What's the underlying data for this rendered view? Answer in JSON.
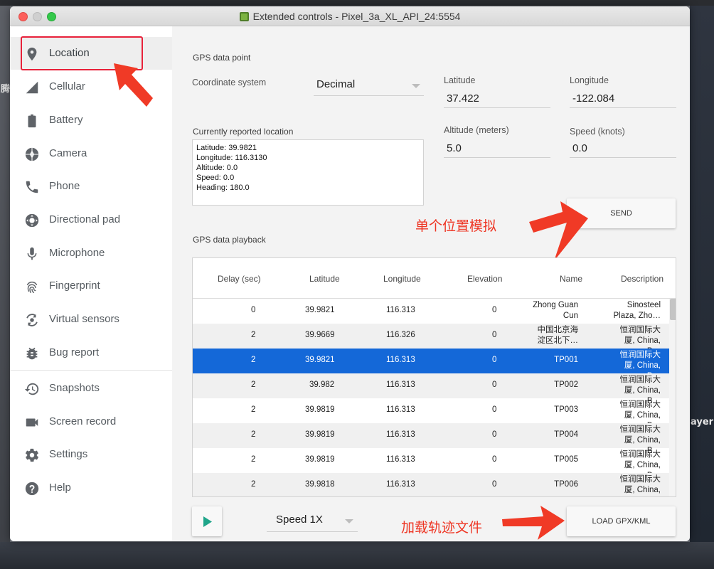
{
  "window": {
    "title": "Extended controls - Pixel_3a_XL_API_24:5554"
  },
  "desktop": {
    "right_edge_text": "ayer",
    "left_edge_text": "腾"
  },
  "sidebar": {
    "items": [
      {
        "label": "Location",
        "icon": "location-pin-icon",
        "active": true
      },
      {
        "label": "Cellular",
        "icon": "cellular-signal-icon"
      },
      {
        "label": "Battery",
        "icon": "battery-icon"
      },
      {
        "label": "Camera",
        "icon": "camera-aperture-icon"
      },
      {
        "label": "Phone",
        "icon": "phone-icon"
      },
      {
        "label": "Directional pad",
        "icon": "dpad-icon"
      },
      {
        "label": "Microphone",
        "icon": "microphone-icon"
      },
      {
        "label": "Fingerprint",
        "icon": "fingerprint-icon"
      },
      {
        "label": "Virtual sensors",
        "icon": "rotation-sensor-icon"
      },
      {
        "label": "Bug report",
        "icon": "bug-icon"
      },
      {
        "label": "Snapshots",
        "icon": "history-clock-icon"
      },
      {
        "label": "Screen record",
        "icon": "video-camera-icon"
      },
      {
        "label": "Settings",
        "icon": "gear-icon"
      },
      {
        "label": "Help",
        "icon": "help-circle-icon"
      }
    ]
  },
  "gps_point": {
    "section_title": "GPS data point",
    "coordinate_system_label": "Coordinate system",
    "coordinate_system_value": "Decimal",
    "latitude_label": "Latitude",
    "latitude_value": "37.422",
    "longitude_label": "Longitude",
    "longitude_value": "-122.084",
    "altitude_label": "Altitude (meters)",
    "altitude_value": "5.0",
    "speed_label": "Speed (knots)",
    "speed_value": "0.0",
    "reported_label": "Currently reported location",
    "reported_lines": [
      "Latitude: 39.9821",
      "Longitude: 116.3130",
      "Altitude: 0.0",
      "Speed: 0.0",
      "Heading: 180.0"
    ],
    "send_label": "SEND"
  },
  "playback": {
    "section_title": "GPS data playback",
    "columns": [
      "Delay (sec)",
      "Latitude",
      "Longitude",
      "Elevation",
      "Name",
      "Description"
    ],
    "rows": [
      {
        "delay": "0",
        "lat": "39.9821",
        "lon": "116.313",
        "elev": "0",
        "name": [
          "Zhong Guan",
          "Cun"
        ],
        "desc": [
          "Sinosteel",
          "Plaza, Zho…"
        ]
      },
      {
        "delay": "2",
        "lat": "39.9669",
        "lon": "116.326",
        "elev": "0",
        "name": [
          "中国北京海",
          "淀区北下…"
        ],
        "desc": [
          "恒润国际大",
          "厦, China, B…"
        ]
      },
      {
        "delay": "2",
        "lat": "39.9821",
        "lon": "116.313",
        "elev": "0",
        "name": [
          "TP001"
        ],
        "desc": [
          "恒润国际大",
          "厦, China, B…"
        ],
        "selected": true
      },
      {
        "delay": "2",
        "lat": "39.982",
        "lon": "116.313",
        "elev": "0",
        "name": [
          "TP002"
        ],
        "desc": [
          "恒润国际大",
          "厦, China, B…"
        ]
      },
      {
        "delay": "2",
        "lat": "39.9819",
        "lon": "116.313",
        "elev": "0",
        "name": [
          "TP003"
        ],
        "desc": [
          "恒润国际大",
          "厦, China, B…"
        ]
      },
      {
        "delay": "2",
        "lat": "39.9819",
        "lon": "116.313",
        "elev": "0",
        "name": [
          "TP004"
        ],
        "desc": [
          "恒润国际大",
          "厦, China, B…"
        ]
      },
      {
        "delay": "2",
        "lat": "39.9819",
        "lon": "116.313",
        "elev": "0",
        "name": [
          "TP005"
        ],
        "desc": [
          "恒润国际大",
          "厦, China, B…"
        ]
      },
      {
        "delay": "2",
        "lat": "39.9818",
        "lon": "116.313",
        "elev": "0",
        "name": [
          "TP006"
        ],
        "desc": [
          "恒润国际大",
          "厦, China, B…"
        ]
      }
    ],
    "speed_value": "Speed 1X",
    "load_label": "LOAD GPX/KML"
  },
  "annotations": {
    "single_location": "单个位置模拟",
    "load_track": "加载轨迹文件",
    "color": "#ee3523"
  },
  "colors": {
    "selection": "#1468d8",
    "play_icon": "#1fa58a",
    "icon_gray": "#5f6368"
  }
}
